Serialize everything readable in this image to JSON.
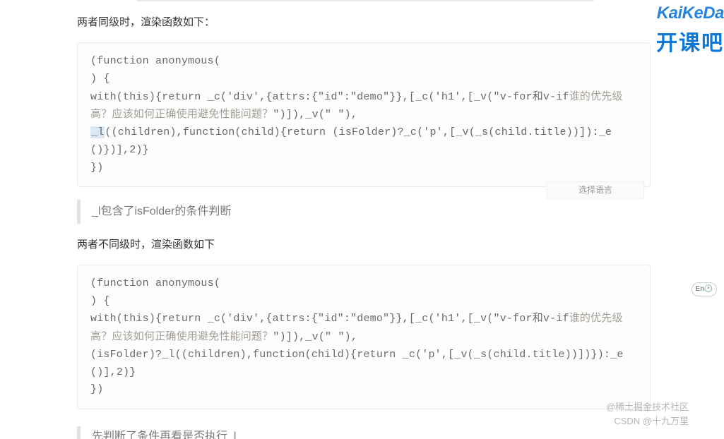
{
  "logo": {
    "brand_latin": "KaiKeDa",
    "brand_cn": "开课吧"
  },
  "para1": "两者同级时，渲染函数如下：",
  "code1": {
    "l1": "(function anonymous(",
    "l2": ") {",
    "l3a": "with(this){return _c('div',{attrs:{\"id\":\"demo\"}},[_c('h1',[_v(\"v-for和v-if",
    "l3b": "谁的优先级高？应该如何正确使用避免性能问题？",
    "l3c": "\")]),_v(\" \"),",
    "l4_hl": "_l",
    "l4_rest": "((children),function(child){return (isFolder)?_c('p',[_v(_s(child.title))]):_e()})],2)}",
    "l5": "})"
  },
  "lang_select": "选择语言",
  "quote1": "_l包含了isFolder的条件判断",
  "para2": "两者不同级时，渲染函数如下",
  "code2": {
    "l1": "(function anonymous(",
    "l2": ") {",
    "l3a": "with(this){return _c('div',{attrs:{\"id\":\"demo\"}},[_c('h1',[_v(\"v-for和v-if",
    "l3b": "谁的优先级高？应该如何正确使用避免性能问题？",
    "l3c": "\")]),_v(\" \"),",
    "l4": "(isFolder)?_l((children),function(child){return _c('p',[_v(_s(child.title))])}):_e()],2)}",
    "l5": "})"
  },
  "quote2": "先判断了条件再看是否执行_l",
  "wm": {
    "top": "@稀土掘金技术社区",
    "bottom": "CSDN @十九万里"
  },
  "pill": "En🕐"
}
